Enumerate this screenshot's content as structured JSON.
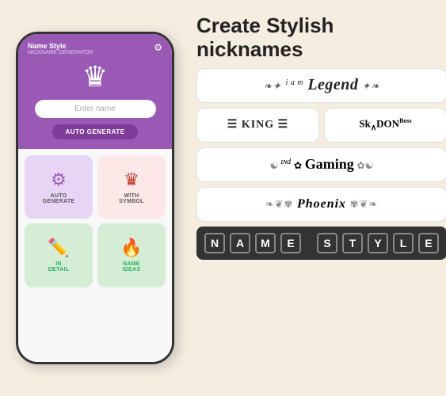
{
  "app": {
    "name": "Name Style",
    "subtitle": "NICKNAME GENERATOR"
  },
  "phone": {
    "input_placeholder": "Enter name",
    "auto_generate_label": "AUTO GENERATE",
    "header_bg": "#9b59b6"
  },
  "menu_cards": [
    {
      "id": "auto-generate",
      "label": "AUTO\nGENERATE",
      "icon": "⚙️",
      "style": "auto"
    },
    {
      "id": "with-symbol",
      "label": "WITH\nSYMBOL",
      "icon": "♛",
      "style": "symbol"
    },
    {
      "id": "in-detail",
      "label": "IN\nDETAIL",
      "icon": "✏️",
      "style": "detail"
    },
    {
      "id": "name-ideas",
      "label": "NAME\nIDEAS",
      "icon": "🔥",
      "style": "ideas"
    }
  ],
  "headline": {
    "line1": "Create Stylish",
    "line2": "nicknames"
  },
  "nickname_examples": [
    {
      "id": "legend",
      "text": "i a m Legend",
      "type": "decorated"
    },
    {
      "id": "king",
      "text": "≡ KING ≡",
      "type": "bold"
    },
    {
      "id": "skadon",
      "text": "SkaDONBoss",
      "type": "bold"
    },
    {
      "id": "gaming",
      "text": "ɪɴd♣Gaming",
      "type": "decorated"
    },
    {
      "id": "phoenix",
      "text": "❧Phoenix❧",
      "type": "ornate"
    }
  ],
  "name_style_letters": [
    "N",
    "A",
    "M",
    "E",
    "S",
    "T",
    "Y",
    "L",
    "E"
  ]
}
